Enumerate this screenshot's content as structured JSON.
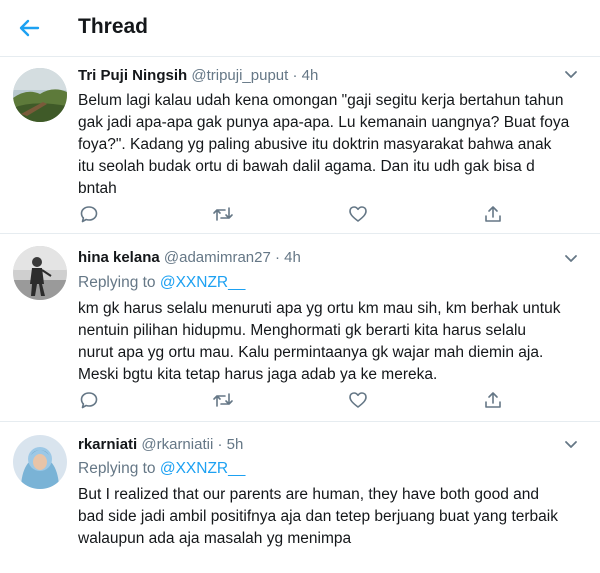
{
  "header": {
    "title": "Thread",
    "back_icon": "back-arrow-icon",
    "accent_color": "#1da1f2"
  },
  "tweets": [
    {
      "name": "Tri Puji Ningsih",
      "handle": "@tripuji_puput",
      "separator": "·",
      "time": "4h",
      "replying_prefix": "",
      "replying_mention": "",
      "lines": [
        "Belum lagi kalau udah kena omongan \"gaji segitu kerja bertahun tahun",
        "gak jadi apa-apa gak punya apa-apa. Lu kemanain uangnya? Buat foya",
        "foya?\". Kadang yg paling abusive itu doktrin masyarakat bahwa anak",
        "itu seolah budak ortu di bawah dalil agama. Dan itu udh gak bisa d",
        "bntah"
      ]
    },
    {
      "name": "hina kelana",
      "handle": "@adamimran27",
      "separator": "·",
      "time": "4h",
      "replying_prefix": "Replying to",
      "replying_mention": "@XXNZR__",
      "lines": [
        "km gk harus selalu menuruti apa yg ortu km mau sih, km berhak untuk",
        "nentuin pilihan hidupmu. Menghormati gk berarti kita harus selalu",
        "nurut apa yg ortu mau. Kalu permintaanya gk wajar mah diemin aja.",
        "Meski bgtu kita tetap harus jaga adab ya ke mereka."
      ]
    },
    {
      "name": "rkarniati",
      "handle": "@rkarniatii",
      "separator": "·",
      "time": "5h",
      "replying_prefix": "Replying to",
      "replying_mention": "@XXNZR__",
      "lines": [
        "But I realized that our parents are human, they have both good and",
        "bad side jadi ambil positifnya aja dan tetep berjuang buat yang terbaik",
        "walaupun ada aja masalah yg menimpa"
      ]
    }
  ],
  "icons": {
    "reply": "reply-icon",
    "retweet": "retweet-icon",
    "like": "like-icon",
    "share": "share-icon",
    "menu": "chevron-down-icon"
  }
}
